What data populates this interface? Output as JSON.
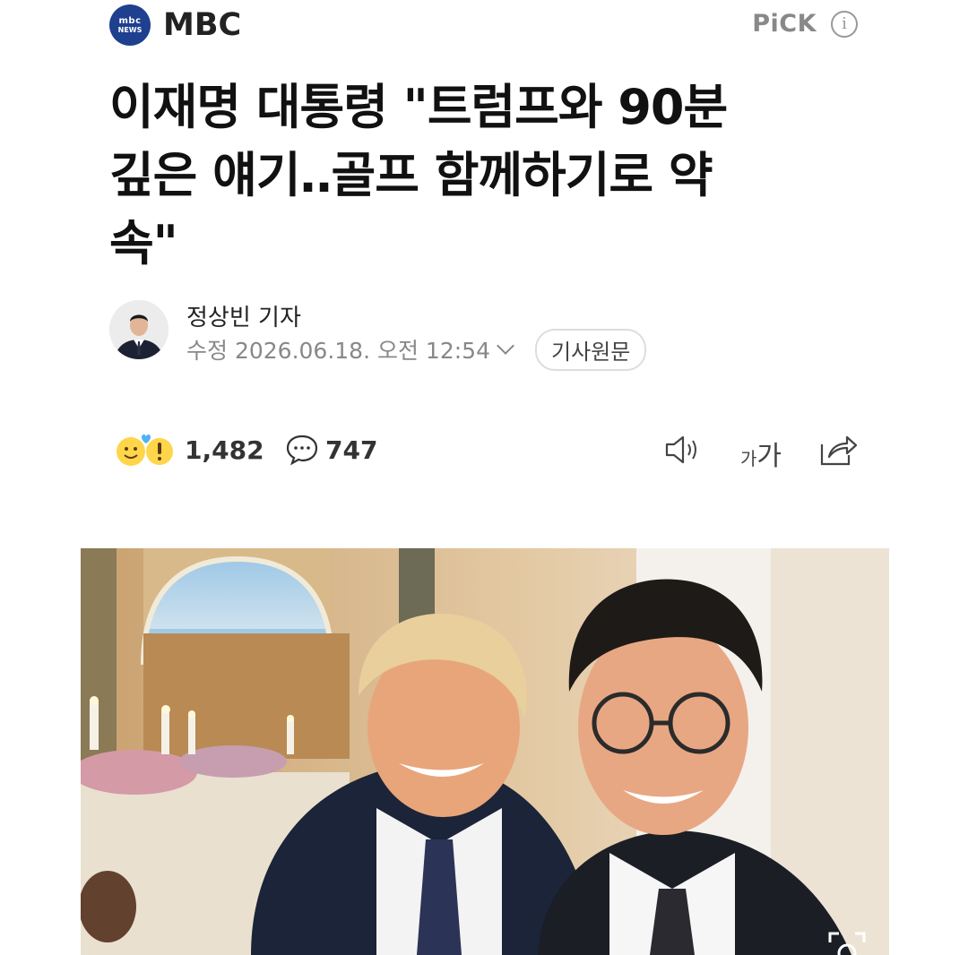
{
  "header": {
    "logo_line1": "mbc",
    "logo_line2": "NEWS",
    "press_name": "MBC",
    "pick_label": "PiCK",
    "info_icon": "info-icon"
  },
  "article": {
    "title_lines": [
      "이재명 대통령 \"트럼프와 90분",
      "깊은 얘기‥골프 함께하기로 약",
      "속\""
    ],
    "reporter": "정상빈 기자",
    "modified_date": "수정 2026.06.18. 오전 12:54",
    "original_link_label": "기사원문"
  },
  "reactions": {
    "likes": "1,482",
    "comments": "747",
    "icons": [
      "smile-emoji-icon",
      "heart-icon",
      "surprise-emoji-icon",
      "comment-icon",
      "speaker-icon",
      "font-size-icon",
      "share-icon"
    ],
    "font_size_small": "가",
    "font_size_large": "가"
  },
  "photo": {
    "icon": "zoom-icon"
  },
  "colors": {
    "brand_blue": "#1f3f8f",
    "muted_text": "#888888",
    "emoji_yellow": "#ffd54a"
  }
}
